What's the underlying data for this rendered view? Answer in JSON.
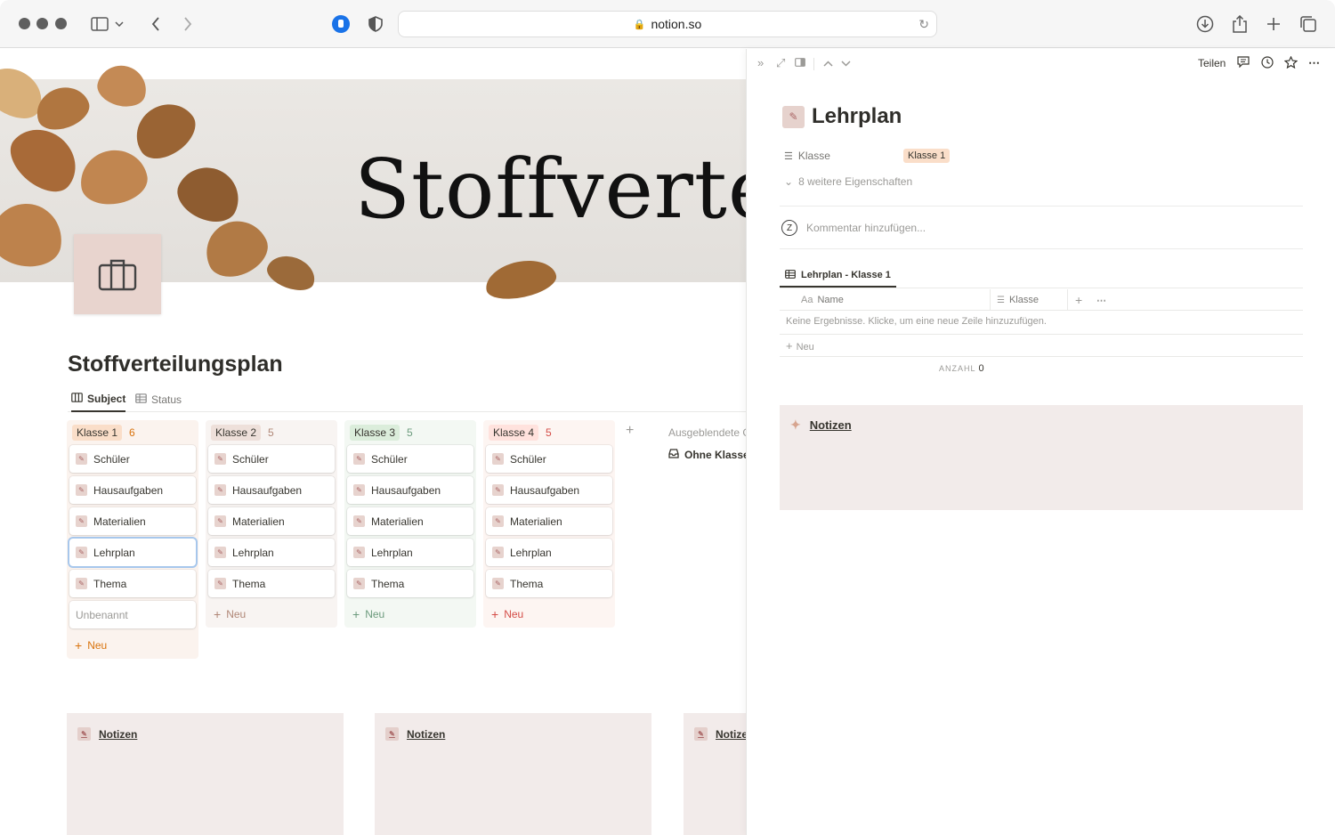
{
  "browser": {
    "url": "notion.so",
    "icons": [
      "sidebar-icon",
      "back-icon",
      "forward-icon",
      "shield-icon",
      "download-icon",
      "share-icon",
      "new-tab-icon",
      "tabs-overview-icon"
    ]
  },
  "page": {
    "cover_text": "Stoffverte",
    "title": "Stoffverteilungsplan",
    "views": [
      {
        "label": "Subject",
        "active": true
      },
      {
        "label": "Status",
        "active": false
      }
    ]
  },
  "board": {
    "columns": [
      {
        "tag": "Klasse 1",
        "count": "6",
        "tag_bg": "#fadec9",
        "col_bg": "#fbf3ee",
        "count_color": "#d9730d",
        "cards": [
          "Schüler",
          "Hausaufgaben",
          "Materialien",
          "Lehrplan",
          "Thema",
          "Unbenannt"
        ],
        "new_label": "Neu"
      },
      {
        "tag": "Klasse 2",
        "count": "5",
        "tag_bg": "#eee0da",
        "col_bg": "#f8f4f2",
        "count_color": "#b08777",
        "cards": [
          "Schüler",
          "Hausaufgaben",
          "Materialien",
          "Lehrplan",
          "Thema"
        ],
        "new_label": "Neu"
      },
      {
        "tag": "Klasse 3",
        "count": "5",
        "tag_bg": "#dbeddb",
        "col_bg": "#f3f8f3",
        "count_color": "#6c9b7d",
        "cards": [
          "Schüler",
          "Hausaufgaben",
          "Materialien",
          "Lehrplan",
          "Thema"
        ],
        "new_label": "Neu"
      },
      {
        "tag": "Klasse 4",
        "count": "5",
        "tag_bg": "#ffe2dd",
        "col_bg": "#fdf5f2",
        "count_color": "#d44c47",
        "cards": [
          "Schüler",
          "Hausaufgaben",
          "Materialien",
          "Lehrplan",
          "Thema"
        ],
        "new_label": "Neu"
      }
    ],
    "hidden_label": "Ausgeblendete G",
    "hidden_item": "Ohne Klasse"
  },
  "notes_boxes": [
    "Notizen",
    "Notizen",
    "Notize"
  ],
  "panel": {
    "share": "Teilen",
    "title": "Lehrplan",
    "prop_label": "Klasse",
    "prop_value": "Klasse 1",
    "more_props": "8 weitere Eigenschaften",
    "comment_avatar": "Z",
    "comment_placeholder": "Kommentar hinzufügen...",
    "db_tab": "Lehrplan - Klasse 1",
    "col_name_prefix": "Aa",
    "col_name": "Name",
    "col_klasse": "Klasse",
    "empty_text": "Keine Ergebnisse. Klicke, um eine neue Zeile hinzuzufügen.",
    "new_row": "Neu",
    "anzahl_label": "ANZAHL",
    "anzahl_value": "0",
    "notes_title": "Notizen"
  },
  "colors": {
    "accent_selection": "#a7c7ec",
    "callout_bg": "#f2ebea",
    "tag_orange": "#fadec9"
  }
}
